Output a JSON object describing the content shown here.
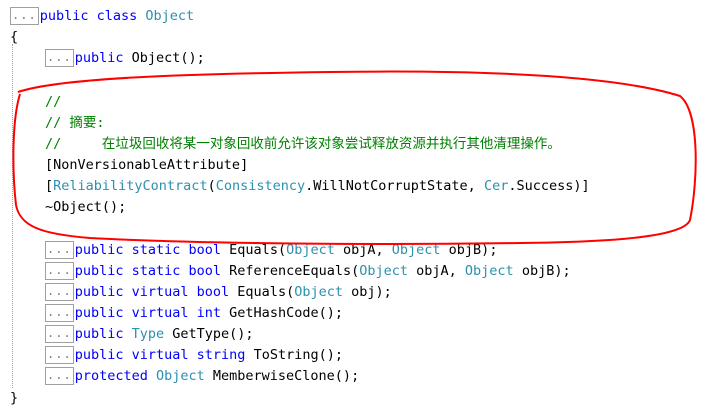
{
  "collapse_glyph": "...",
  "code": {
    "class_decl": {
      "mod": "public",
      "kw": "class",
      "name": "Object"
    },
    "open_brace": "{",
    "close_brace": "}",
    "ctor": {
      "mod": "public",
      "name": "Object",
      "tail": "();"
    },
    "comment1": "//",
    "comment2": "// 摘要:",
    "comment3": "//     在垃圾回收将某一对象回收前允许该对象尝试释放资源并执行其他清理操作。",
    "attr1": "[NonVersionableAttribute]",
    "attr2": {
      "open": "[",
      "type": "ReliabilityContract",
      "p1": "(",
      "t2": "Consistency",
      "v2": ".WillNotCorruptState, ",
      "t3": "Cer",
      "v3": ".Success)]"
    },
    "dtor": {
      "pre": "~Object",
      "tail": "();"
    },
    "equals_static": {
      "m1": "public",
      "m2": "static",
      "t": "bool",
      "name": " Equals(",
      "t1": "Object",
      "a1": " objA, ",
      "t2": "Object",
      "a2": " objB);"
    },
    "refequals": {
      "m1": "public",
      "m2": "static",
      "t": "bool",
      "name": " ReferenceEquals(",
      "t1": "Object",
      "a1": " objA, ",
      "t2": "Object",
      "a2": " objB);"
    },
    "equals_virtual": {
      "m1": "public",
      "m2": "virtual",
      "t": "bool",
      "name": " Equals(",
      "t1": "Object",
      "a1": " obj);"
    },
    "hashcode": {
      "m1": "public",
      "m2": "virtual",
      "t": "int",
      "name": " GetHashCode();"
    },
    "gettype": {
      "m1": "public",
      "t": "Type",
      "name": " GetType();"
    },
    "tostring": {
      "m1": "public",
      "m2": "virtual",
      "t": "string",
      "name": " ToString();"
    },
    "memberwise": {
      "m1": "protected",
      "t": "Object",
      "name": " MemberwiseClone();"
    }
  },
  "colors": {
    "keyword": "#0000ff",
    "type": "#2b91af",
    "comment": "#008000",
    "annotation": "#ff0000"
  }
}
